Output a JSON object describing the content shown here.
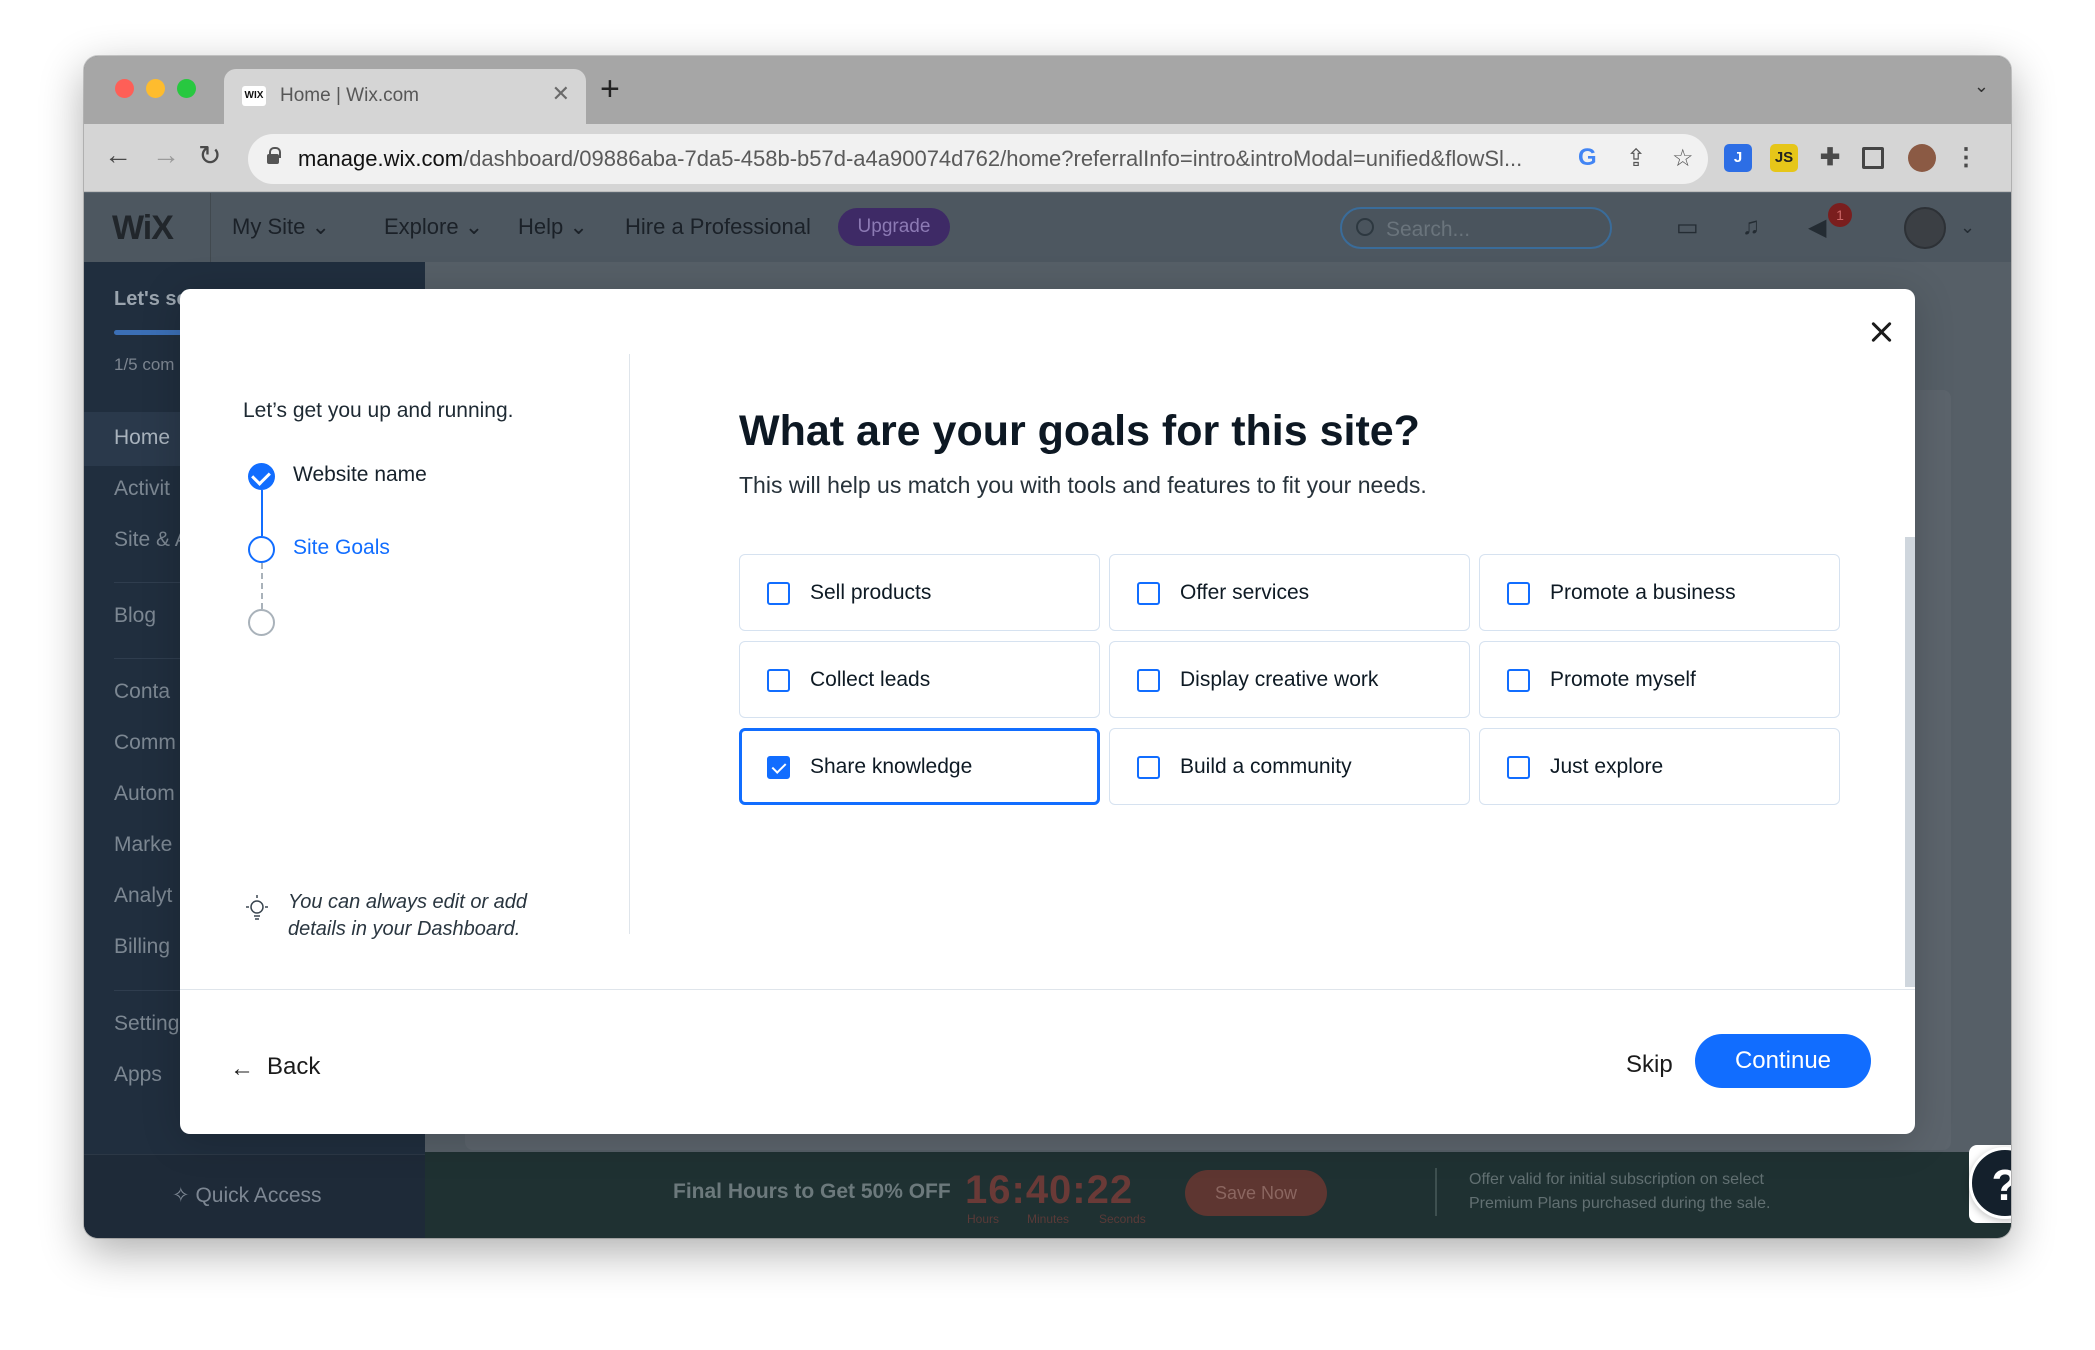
{
  "browser": {
    "tab_title": "Home | Wix.com",
    "tab_favicon": "WIX",
    "url_domain": "manage.wix.com",
    "url_path": "/dashboard/09886aba-7da5-458b-b57d-a4a90074d762/home?referralInfo=intro&introModal=unified&flowSl...",
    "extension_badges": [
      "J",
      "JS"
    ]
  },
  "wix_header": {
    "logo": "WiX",
    "nav": [
      "My Site",
      "Explore",
      "Help",
      "Hire a Professional"
    ],
    "upgrade": "Upgrade",
    "search_placeholder": "Search...",
    "notification_count": "1"
  },
  "sidebar": {
    "title": "Let's se",
    "progress_text": "1/5 com",
    "items": [
      "Home",
      "Activit",
      "Site & A",
      "Blog",
      "Conta",
      "Comm",
      "Autom",
      "Marke",
      "Analyt",
      "Billing",
      "Setting",
      "Apps"
    ],
    "quick_access": "Quick Access"
  },
  "promo_bar": {
    "headline": "Final Hours to Get 50% OFF",
    "timer": "16:40:22",
    "timer_units": [
      "Hours",
      "Minutes",
      "Seconds"
    ],
    "button": "Save Now",
    "offer": [
      "Offer valid for initial subscription on select",
      "Premium Plans purchased during the sale."
    ]
  },
  "modal": {
    "intro": "Let’s get you up and running.",
    "steps": [
      {
        "label": "Website name",
        "state": "done"
      },
      {
        "label": "Site Goals",
        "state": "current"
      },
      {
        "label": "",
        "state": "upcoming"
      }
    ],
    "tip_line1": "You can always edit or add",
    "tip_line2": "details in your Dashboard.",
    "heading": "What are your goals for this site?",
    "subheading": "This will help us match you with tools and features to fit your needs.",
    "options": [
      {
        "label": "Sell products",
        "checked": false
      },
      {
        "label": "Offer services",
        "checked": false
      },
      {
        "label": "Promote a business",
        "checked": false
      },
      {
        "label": "Collect leads",
        "checked": false
      },
      {
        "label": "Display creative work",
        "checked": false
      },
      {
        "label": "Promote myself",
        "checked": false
      },
      {
        "label": "Share knowledge",
        "checked": true
      },
      {
        "label": "Build a community",
        "checked": false
      },
      {
        "label": "Just explore",
        "checked": false
      }
    ],
    "back": "Back",
    "skip": "Skip",
    "continue": "Continue"
  },
  "help_button": "?",
  "colors": {
    "accent": "#116dff",
    "heading": "#0d1823",
    "overlay_sidebar": "#202e3e",
    "upgrade": "#3e2a66"
  }
}
